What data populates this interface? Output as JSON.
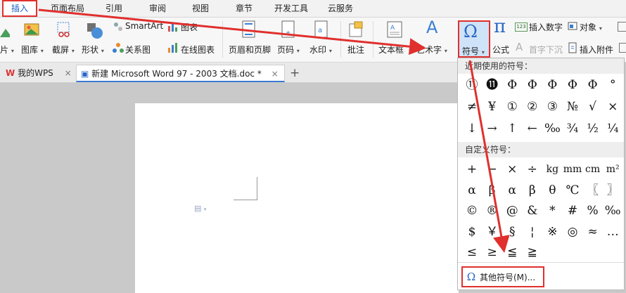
{
  "menu": {
    "tabs": [
      "插入",
      "页面布局",
      "引用",
      "审阅",
      "视图",
      "章节",
      "开发工具",
      "云服务"
    ],
    "active": "插入"
  },
  "ribbon": {
    "partial_left": "片",
    "gallery": "图库",
    "screenshot": "截屏",
    "shapes": "形状",
    "smartart": "SmartArt",
    "chart": "图表",
    "relation": "关系图",
    "online_chart": "在线图表",
    "header_footer": "页眉和页脚",
    "page_number": "页码",
    "watermark": "水印",
    "comment": "批注",
    "textbox": "文本框",
    "wordart": "艺术字",
    "symbol": "符号",
    "formula": "公式",
    "insert_number_badge": "123",
    "insert_number": "插入数字",
    "object": "对象",
    "dropcap": "首字下沉",
    "attachment": "插入附件",
    "caret": "▾"
  },
  "doc_tabs": {
    "mywps": "我的WPS",
    "document": "新建 Microsoft Word 97 - 2003 文档.doc *",
    "close": "×",
    "add": "+"
  },
  "symbol_panel": {
    "recent_title": "近期使用的符号：",
    "recent": [
      "⑪",
      "⓫",
      "Φ",
      "Φ",
      "Φ",
      "Φ",
      "Φ",
      "°",
      "≠",
      "¥",
      "①",
      "②",
      "③",
      "№",
      "√",
      "×",
      "↓",
      "→",
      "↑",
      "←",
      "‰",
      "¾",
      "½",
      "¼"
    ],
    "custom_title": "自定义符号：",
    "custom": [
      "+",
      "−",
      "×",
      "÷",
      "kg",
      "mm",
      "cm",
      "m²",
      "α",
      "β",
      "α",
      "β",
      "θ",
      "℃",
      "〖",
      "〗",
      "©",
      "®",
      "@",
      "&",
      "*",
      "#",
      "%",
      "‰",
      "$",
      "￥",
      "§",
      "¦",
      "※",
      "◎",
      "≈",
      "…",
      "≤",
      "≥",
      "≦",
      "≧"
    ],
    "more_icon": "Ω",
    "more_label": "其他符号(M)..."
  },
  "colors": {
    "highlight": "#e0302d",
    "accent_blue": "#2b67c5"
  }
}
